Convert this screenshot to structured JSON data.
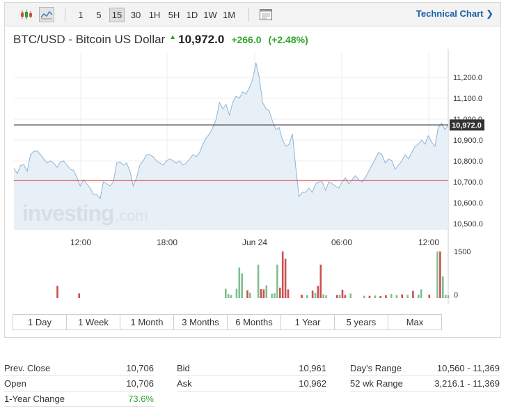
{
  "toolbar": {
    "chart_type_icons": [
      "candlestick-icon",
      "area-chart-icon"
    ],
    "timeframes": [
      "1",
      "5",
      "15",
      "30",
      "1H",
      "5H",
      "1D",
      "1W",
      "1M"
    ],
    "active_timeframe": "15",
    "settings_icon": "window-icon",
    "technical_link": "Technical Chart ❯"
  },
  "quote": {
    "name": "BTC/USD - Bitcoin US Dollar",
    "direction_icon": "up-arrow-icon",
    "last": "10,972.0",
    "change": "+266.0",
    "change_pct": "(+2.48%)"
  },
  "watermark": {
    "brand": "investing",
    "suffix": ".com"
  },
  "chart_data": {
    "type": "area",
    "instrument": "BTC/USD",
    "x_labels": [
      "12:00",
      "18:00",
      "Jun 24",
      "06:00",
      "12:00"
    ],
    "y_ticks": [
      10500,
      10600,
      10700,
      10800,
      10900,
      11000,
      11100,
      11200
    ],
    "y_tick_labels": [
      "10,500.0",
      "10,600.0",
      "10,700.0",
      "10,800.0",
      "10,900.0",
      "11,000.0",
      "11,100.0",
      "11,200.0"
    ],
    "ylim": [
      10470,
      11320
    ],
    "price_line": {
      "value": 10972,
      "label": "10,972.0"
    },
    "prev_close_line": {
      "value": 10706
    },
    "price": [
      10765,
      10740,
      10778,
      10782,
      10750,
      10830,
      10845,
      10848,
      10830,
      10810,
      10790,
      10800,
      10790,
      10770,
      10795,
      10800,
      10780,
      10760,
      10755,
      10720,
      10680,
      10710,
      10690,
      10670,
      10640,
      10640,
      10620,
      10700,
      10690,
      10680,
      10700,
      10790,
      10795,
      10780,
      10790,
      10750,
      10680,
      10720,
      10780,
      10800,
      10830,
      10830,
      10820,
      10800,
      10790,
      10780,
      10800,
      10810,
      10800,
      10790,
      10800,
      10780,
      10790,
      10810,
      10830,
      10820,
      10840,
      10880,
      10910,
      10930,
      10960,
      11000,
      11080,
      11050,
      11070,
      11020,
      11080,
      11110,
      11100,
      11130,
      11120,
      11150,
      11190,
      11270,
      11200,
      11080,
      11050,
      11040,
      10990,
      10950,
      10960,
      10900,
      10870,
      10880,
      10930,
      10770,
      10630,
      10650,
      10650,
      10670,
      10650,
      10690,
      10700,
      10700,
      10660,
      10700,
      10690,
      10680,
      10670,
      10700,
      10720,
      10690,
      10710,
      10730,
      10710,
      10700,
      10720,
      10750,
      10780,
      10810,
      10840,
      10830,
      10790,
      10810,
      10800,
      10760,
      10780,
      10800,
      10830,
      10810,
      10840,
      10870,
      10880,
      10900,
      10880,
      10920,
      10890,
      10870,
      10960,
      10980,
      10950,
      10972
    ],
    "volume_ticks": [
      0,
      1500
    ],
    "volume_ylim": [
      0,
      1600
    ],
    "volume_bars": [
      {
        "i": 16,
        "v": 420,
        "c": "down"
      },
      {
        "i": 24,
        "v": 160,
        "c": "down"
      },
      {
        "i": 78,
        "v": 320,
        "c": "up"
      },
      {
        "i": 79,
        "v": 140,
        "c": "up"
      },
      {
        "i": 80,
        "v": 110,
        "c": "up"
      },
      {
        "i": 82,
        "v": 320,
        "c": "up"
      },
      {
        "i": 83,
        "v": 1050,
        "c": "up"
      },
      {
        "i": 84,
        "v": 850,
        "c": "up"
      },
      {
        "i": 86,
        "v": 270,
        "c": "down"
      },
      {
        "i": 87,
        "v": 180,
        "c": "up"
      },
      {
        "i": 90,
        "v": 1150,
        "c": "up"
      },
      {
        "i": 91,
        "v": 310,
        "c": "down"
      },
      {
        "i": 92,
        "v": 300,
        "c": "down"
      },
      {
        "i": 93,
        "v": 440,
        "c": "up"
      },
      {
        "i": 95,
        "v": 150,
        "c": "up"
      },
      {
        "i": 96,
        "v": 170,
        "c": "up"
      },
      {
        "i": 97,
        "v": 1150,
        "c": "up"
      },
      {
        "i": 98,
        "v": 360,
        "c": "down"
      },
      {
        "i": 99,
        "v": 1600,
        "c": "down"
      },
      {
        "i": 100,
        "v": 1350,
        "c": "down"
      },
      {
        "i": 101,
        "v": 300,
        "c": "down"
      },
      {
        "i": 106,
        "v": 120,
        "c": "down"
      },
      {
        "i": 108,
        "v": 110,
        "c": "up"
      },
      {
        "i": 110,
        "v": 260,
        "c": "down"
      },
      {
        "i": 111,
        "v": 180,
        "c": "up"
      },
      {
        "i": 112,
        "v": 420,
        "c": "down"
      },
      {
        "i": 113,
        "v": 1150,
        "c": "down"
      },
      {
        "i": 114,
        "v": 130,
        "c": "up"
      },
      {
        "i": 115,
        "v": 100,
        "c": "up"
      },
      {
        "i": 119,
        "v": 110,
        "c": "down"
      },
      {
        "i": 120,
        "v": 120,
        "c": "up"
      },
      {
        "i": 121,
        "v": 290,
        "c": "down"
      },
      {
        "i": 122,
        "v": 110,
        "c": "down"
      },
      {
        "i": 124,
        "v": 160,
        "c": "up"
      },
      {
        "i": 129,
        "v": 80,
        "c": "up"
      },
      {
        "i": 131,
        "v": 80,
        "c": "down"
      },
      {
        "i": 133,
        "v": 90,
        "c": "up"
      },
      {
        "i": 135,
        "v": 70,
        "c": "down"
      },
      {
        "i": 137,
        "v": 100,
        "c": "down"
      },
      {
        "i": 139,
        "v": 140,
        "c": "up"
      },
      {
        "i": 141,
        "v": 110,
        "c": "up"
      },
      {
        "i": 143,
        "v": 130,
        "c": "down"
      },
      {
        "i": 145,
        "v": 110,
        "c": "up"
      },
      {
        "i": 147,
        "v": 250,
        "c": "down"
      },
      {
        "i": 149,
        "v": 120,
        "c": "up"
      },
      {
        "i": 150,
        "v": 300,
        "c": "up"
      },
      {
        "i": 153,
        "v": 120,
        "c": "down"
      },
      {
        "i": 156,
        "v": 1950,
        "c": "up"
      },
      {
        "i": 157,
        "v": 1800,
        "c": "down"
      },
      {
        "i": 158,
        "v": 750,
        "c": "up"
      },
      {
        "i": 159,
        "v": 120,
        "c": "up"
      },
      {
        "i": 160,
        "v": 100,
        "c": "up"
      }
    ],
    "volume_bar_count": 161
  },
  "range_buttons": [
    "1 Day",
    "1 Week",
    "1 Month",
    "3 Months",
    "6 Months",
    "1 Year",
    "5 years",
    "Max"
  ],
  "stats": {
    "col1": [
      {
        "label": "Prev. Close",
        "value": "10,706"
      },
      {
        "label": "Open",
        "value": "10,706"
      },
      {
        "label": "1-Year Change",
        "value": "73.6%"
      }
    ],
    "col2": [
      {
        "label": "Bid",
        "value": "10,961"
      },
      {
        "label": "Ask",
        "value": "10,962"
      }
    ],
    "col3": [
      {
        "label": "Day's Range",
        "value": "10,560 - 11,369"
      },
      {
        "label": "52 wk Range",
        "value": "3,216.1 - 11,369"
      }
    ]
  },
  "colors": {
    "area_fill": "#e3edf6",
    "area_line": "#8fb3d6",
    "price_line": "#444444",
    "prev_close_line": "#d9393b",
    "vol_up": "#7fbf8f",
    "vol_down": "#c9514f",
    "grid": "#ececec",
    "positive": "#2ba52b",
    "link": "#1a5ea8"
  }
}
